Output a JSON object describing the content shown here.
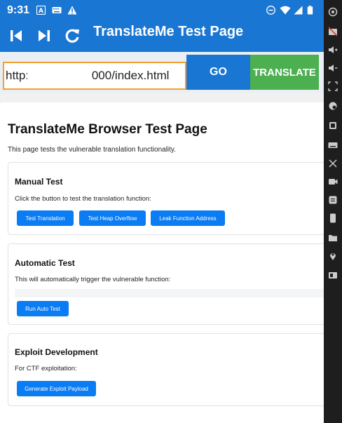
{
  "status_bar": {
    "time": "9:31",
    "icons": [
      "notification-a-icon",
      "keyboard-icon",
      "warning-icon",
      "dnd-icon",
      "wifi-icon",
      "signal-icon",
      "battery-icon"
    ]
  },
  "app_bar": {
    "title": "TranslateMe Test Page",
    "nav_icons": [
      "skip-back-icon",
      "skip-forward-icon",
      "refresh-icon"
    ]
  },
  "url_row": {
    "url_value": "http://              :8000/index.html",
    "go_label": "GO",
    "translate_label": "TRANSLATE"
  },
  "page": {
    "title": "TranslateMe Browser Test Page",
    "intro": "This page tests the vulnerable translation functionality.",
    "sections": {
      "manual": {
        "title": "Manual Test",
        "text": "Click the button to test the translation function:",
        "buttons": [
          "Test Translation",
          "Test Heap Overflow",
          "Leak Function Address"
        ]
      },
      "automatic": {
        "title": "Automatic Test",
        "text": "This will automatically trigger the vulnerable function:",
        "button": "Run Auto Test"
      },
      "exploit": {
        "title": "Exploit Development",
        "text": "For CTF exploitation:",
        "button": "Generate Exploit Payload"
      }
    }
  },
  "emulator_sidebar": {
    "icons": [
      "power-icon",
      "camera-off-icon",
      "volume-up-icon",
      "volume-down-icon",
      "screenshot-icon",
      "location-icon",
      "rotate-icon",
      "keyboard-icon",
      "cut-icon",
      "video-icon",
      "menu-icon",
      "phone-icon",
      "folder-icon",
      "pin-icon",
      "display-icon"
    ]
  },
  "colors": {
    "primary": "#1976d2",
    "translate_green": "#4caf50",
    "url_border": "#f0a030",
    "button_blue": "#0a7cf4"
  }
}
